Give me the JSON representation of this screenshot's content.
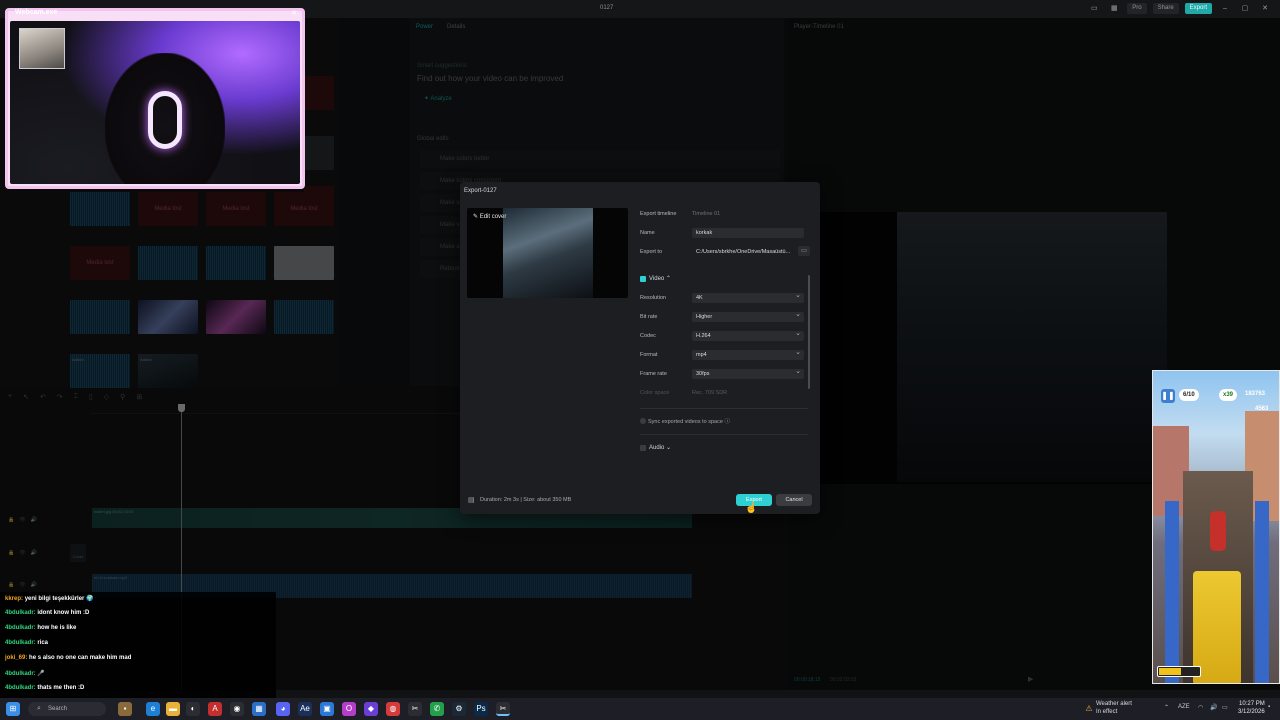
{
  "window": {
    "title": "0127",
    "pro_label": "Pro",
    "share_label": "Share",
    "export_label": "Export"
  },
  "props_panel": {
    "tabs": [
      "Power",
      "Details"
    ],
    "smart_suggestions": "Smart suggestions",
    "headline": "Find out how your video can be improved",
    "analyze": "Analyze",
    "global_edits": "Global edits",
    "edit_items": [
      "Make colors better",
      "Make colors consistent",
      "Make v...",
      "Make v...",
      "Make al...",
      "Reboot..."
    ]
  },
  "media_panel": {
    "lost_label": "Media lost",
    "added_label": "Added"
  },
  "preview": {
    "title": "Player-Timeline 01",
    "current_time": "00:00:18:15",
    "total_time": "00:02:03:03"
  },
  "timeline": {
    "video_clip": "indirel.jpg  00:02:03:03",
    "audio_clip": "en ki kolakalo.mp3",
    "cover_label": "Cover"
  },
  "export_dialog": {
    "title": "Export-0127",
    "edit_cover": "Edit cover",
    "export_timeline_label": "Export timeline",
    "export_timeline_value": "Timeline 01",
    "name_label": "Name",
    "name_value": "korkak",
    "export_to_label": "Export to",
    "export_to_value": "C:/Users/sbrkhe/OneDrive/Masaüstü...",
    "video_section": "Video",
    "resolution_label": "Resolution",
    "resolution_value": "4K",
    "bitrate_label": "Bit rate",
    "bitrate_value": "Higher",
    "codec_label": "Codec",
    "codec_value": "H.264",
    "format_label": "Format",
    "format_value": "mp4",
    "framerate_label": "Frame rate",
    "framerate_value": "30fps",
    "colorspace_label": "Color space",
    "colorspace_value": "Rec. 709 SDR",
    "sync_label": "Sync exported videos to space",
    "audio_section": "Audio",
    "duration_info": "Duration: 2m 3s | Size: about 350 MB",
    "export_button": "Export",
    "cancel_button": "Cancel"
  },
  "webcam": {
    "title": "Webcam.exe"
  },
  "chat": [
    {
      "user": "kkrep:",
      "message": "yeni bilgi teşekkürler 🌍",
      "color_class": "u1"
    },
    {
      "user": "4bdulkadr:",
      "message": "idont know him :D",
      "color_class": "u2"
    },
    {
      "user": "4bdulkadr:",
      "message": "how he is like",
      "color_class": "u2"
    },
    {
      "user": "4bdulkadr:",
      "message": "rica",
      "color_class": "u2"
    },
    {
      "user": "joki_69:",
      "message": "he s also no one can make him mad",
      "color_class": "u1"
    },
    {
      "user": "4bdulkadr:",
      "message": "🎤",
      "color_class": "u2"
    },
    {
      "user": "4bdulkadr:",
      "message": "thats me then :D",
      "color_class": "u2"
    }
  ],
  "game": {
    "keys": "6/10",
    "coins": "x39",
    "score_a": "183763",
    "score_b": "4563"
  },
  "taskbar": {
    "search_placeholder": "Search",
    "weather_title": "Weather alert",
    "weather_sub": "In effect",
    "lang": "AZE",
    "time": "10:27 PM",
    "date": "3/12/2026"
  },
  "colors": {
    "accent": "#2fd0d4",
    "webcam_border": "#f3c4f0",
    "media_lost": "#3a1215"
  }
}
